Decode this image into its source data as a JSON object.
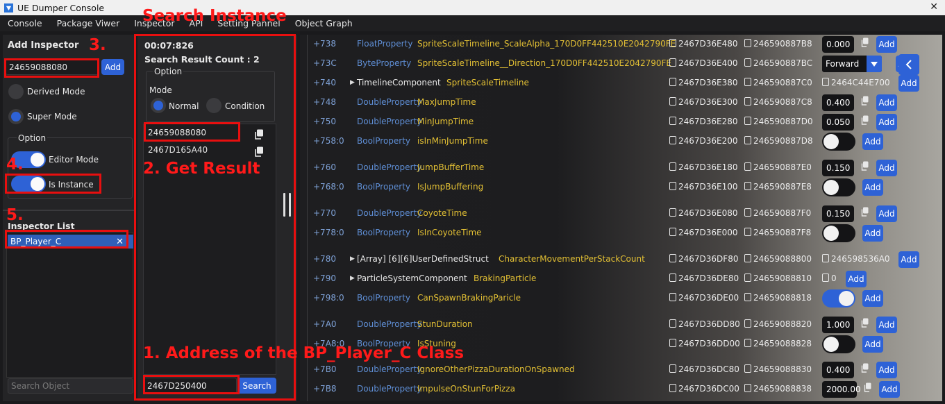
{
  "window": {
    "title": "UE Dumper Console"
  },
  "menu": [
    "Console",
    "Package Viwer",
    "Inspector",
    "API",
    "Setting Pannel",
    "Object Graph"
  ],
  "left": {
    "add_inspector_title": "Add Inspector",
    "address_value": "24659088080",
    "add_label": "Add",
    "derived_mode": "Derived Mode",
    "super_mode": "Super Mode",
    "option_title": "Option",
    "editor_mode": "Editor Mode",
    "is_instance": "Is Instance",
    "inspector_list_title": "Inspector List",
    "inspector_item": "BP_Player_C",
    "search_placeholder": "Search Object"
  },
  "middle": {
    "timer": "00:07:826",
    "result_count": "Search Result Count : 2",
    "option_title": "Option",
    "mode_title": "Mode",
    "mode_normal": "Normal",
    "mode_condition": "Condition",
    "results": [
      "24659088080",
      "2467D165A40"
    ],
    "search_value": "2467D250400",
    "search_label": "Search"
  },
  "annotations": {
    "search_instance": "Search Instance",
    "get_result": "2. Get Result",
    "address_class": "1. Address of the BP_Player_C Class",
    "n3": "3.",
    "n4": "4.",
    "n5": "5."
  },
  "properties": [
    {
      "offset": "+738",
      "type": "FloatProperty",
      "name": "SpriteScaleTimeline_ScaleAlpha_170D0FF442510E2042790FE",
      "addr1": "2467D36E480",
      "addr2": "246590887B8",
      "value": "0.000",
      "kind": "value"
    },
    {
      "offset": "+73C",
      "type": "ByteProperty",
      "name": "SpriteScaleTimeline__Direction_170D0FF442510E2042790FE",
      "addr1": "2467D36E400",
      "addr2": "246590887BC",
      "value": "Forward",
      "kind": "dropdown"
    },
    {
      "offset": "+740",
      "type": "TimelineComponent",
      "name": "SpriteScaleTimeline",
      "addr1": "2467D36E380",
      "addr2": "246590887C0",
      "value": "2464C44E700",
      "kind": "struct"
    },
    {
      "offset": "+748",
      "type": "DoubleProperty",
      "name": "MaxJumpTime",
      "addr1": "2467D36E300",
      "addr2": "246590887C8",
      "value": "0.400",
      "kind": "value"
    },
    {
      "offset": "+750",
      "type": "DoubleProperty",
      "name": "MinJumpTime",
      "addr1": "2467D36E280",
      "addr2": "246590887D0",
      "value": "0.050",
      "kind": "value"
    },
    {
      "offset": "+758:0",
      "type": "BoolProperty",
      "name": "isInMinJumpTime",
      "addr1": "2467D36E200",
      "addr2": "246590887D8",
      "value": "",
      "kind": "bool-off"
    },
    {
      "offset": "+760",
      "type": "DoubleProperty",
      "name": "JumpBufferTime",
      "addr1": "2467D36E180",
      "addr2": "246590887E0",
      "value": "0.150",
      "kind": "value"
    },
    {
      "offset": "+768:0",
      "type": "BoolProperty",
      "name": "IsJumpBuffering",
      "addr1": "2467D36E100",
      "addr2": "246590887E8",
      "value": "",
      "kind": "bool-off"
    },
    {
      "offset": "+770",
      "type": "DoubleProperty",
      "name": "CoyoteTime",
      "addr1": "2467D36E080",
      "addr2": "246590887F0",
      "value": "0.150",
      "kind": "value"
    },
    {
      "offset": "+778:0",
      "type": "BoolProperty",
      "name": "IsInCoyoteTime",
      "addr1": "2467D36E000",
      "addr2": "246590887F8",
      "value": "",
      "kind": "bool-off"
    },
    {
      "offset": "+780",
      "type": "[Array] [6][6]UserDefinedStruct",
      "name": "CharacterMovementPerStackCount",
      "addr1": "2467D36DF80",
      "addr2": "24659088800",
      "value": "246598536A0",
      "kind": "struct"
    },
    {
      "offset": "+790",
      "type": "ParticleSystemComponent",
      "name": "BrakingParticle",
      "addr1": "2467D36DE80",
      "addr2": "24659088810",
      "value": "0",
      "kind": "struct"
    },
    {
      "offset": "+798:0",
      "type": "BoolProperty",
      "name": "CanSpawnBrakingParicle",
      "addr1": "2467D36DE00",
      "addr2": "24659088818",
      "value": "",
      "kind": "bool-on"
    },
    {
      "offset": "+7A0",
      "type": "DoubleProperty",
      "name": "StunDuration",
      "addr1": "2467D36DD80",
      "addr2": "24659088820",
      "value": "1.000",
      "kind": "value"
    },
    {
      "offset": "+7A8:0",
      "type": "BoolProperty",
      "name": "IsStuning",
      "addr1": "2467D36DD00",
      "addr2": "24659088828",
      "value": "",
      "kind": "bool-off"
    },
    {
      "offset": "+7B0",
      "type": "DoubleProperty",
      "name": "IgnoreOtherPizzaDurationOnSpawned",
      "addr1": "2467D36DC80",
      "addr2": "24659088830",
      "value": "0.400",
      "kind": "value"
    },
    {
      "offset": "+7B8",
      "type": "DoubleProperty",
      "name": "ImpulseOnStunForPizza",
      "addr1": "2467D36DC00",
      "addr2": "24659088838",
      "value": "2000.00",
      "kind": "value"
    }
  ],
  "add_label": "Add"
}
